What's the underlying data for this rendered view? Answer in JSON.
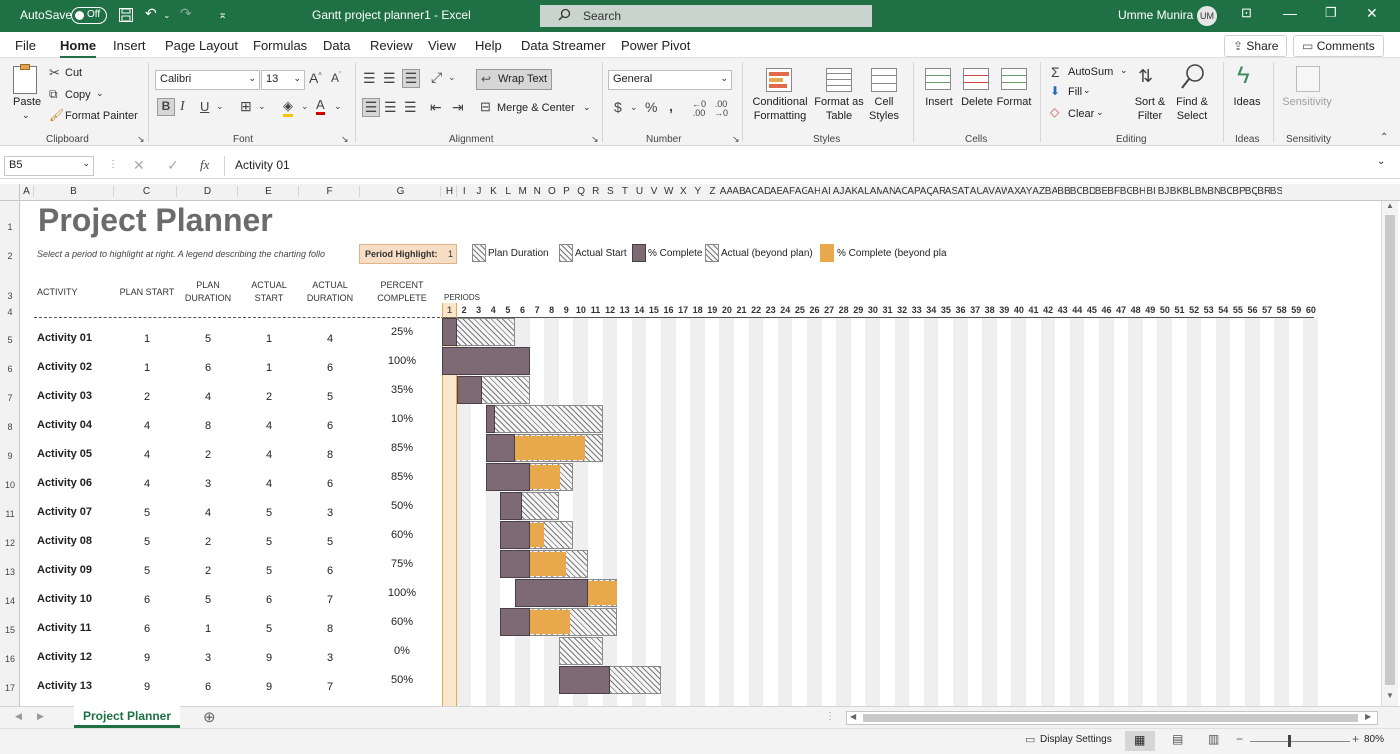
{
  "titlebar": {
    "autosave_label": "AutoSave",
    "autosave_state": "Off",
    "doc_title": "Gantt project planner1  -  Excel",
    "search_placeholder": "Search",
    "user_name": "Umme Munira",
    "user_initials": "UM"
  },
  "menu": {
    "items": [
      "File",
      "Home",
      "Insert",
      "Page Layout",
      "Formulas",
      "Data",
      "Review",
      "View",
      "Help",
      "Data Streamer",
      "Power Pivot"
    ],
    "active": "Home",
    "share": "Share",
    "comments": "Comments"
  },
  "ribbon": {
    "clipboard": {
      "paste": "Paste",
      "cut": "Cut",
      "copy": "Copy",
      "format_painter": "Format Painter",
      "group": "Clipboard"
    },
    "font": {
      "name": "Calibri",
      "size": "13",
      "group": "Font"
    },
    "alignment": {
      "wrap": "Wrap Text",
      "merge": "Merge & Center",
      "group": "Alignment"
    },
    "number": {
      "format": "General",
      "group": "Number"
    },
    "styles": {
      "conditional": "Conditional Formatting",
      "format_table": "Format as Table",
      "cell_styles": "Cell Styles",
      "group": "Styles"
    },
    "cells": {
      "insert": "Insert",
      "delete": "Delete",
      "format": "Format",
      "group": "Cells"
    },
    "editing": {
      "autosum": "AutoSum",
      "fill": "Fill",
      "clear": "Clear",
      "sort": "Sort & Filter",
      "find": "Find & Select",
      "group": "Editing"
    },
    "ideas": {
      "label": "Ideas",
      "group": "Ideas"
    },
    "sensitivity": {
      "label": "Sensitivity",
      "group": "Sensitivity"
    }
  },
  "formula_bar": {
    "name_box": "B5",
    "formula": "Activity 01"
  },
  "sheet": {
    "title": "Project Planner",
    "subtitle": "Select a period to highlight at right.  A legend describing the charting follo",
    "period_highlight_label": "Period Highlight:",
    "period_highlight_value": "1",
    "legend": [
      "Plan Duration",
      "Actual Start",
      "% Complete",
      "Actual (beyond plan)",
      "% Complete (beyond pla"
    ],
    "headers": {
      "activity": "ACTIVITY",
      "plan_start": "PLAN START",
      "plan_duration": "PLAN DURATION",
      "actual_start": "ACTUAL START",
      "actual_duration": "ACTUAL DURATION",
      "percent_complete": "PERCENT COMPLETE",
      "periods": "PERIODS"
    },
    "columns": [
      "A",
      "B",
      "C",
      "D",
      "E",
      "F",
      "G",
      "H",
      "I",
      "J",
      "K",
      "L",
      "M",
      "N",
      "O",
      "P",
      "Q",
      "R",
      "S",
      "T",
      "U",
      "V",
      "W",
      "X",
      "Y",
      "Z",
      "AA",
      "AB",
      "AC",
      "AD",
      "AE",
      "AF",
      "AG",
      "AH",
      "AI",
      "AJ",
      "AK",
      "AL",
      "AM",
      "AN",
      "AO",
      "AP",
      "AQ",
      "AR",
      "AS",
      "AT",
      "AU",
      "AV",
      "AW",
      "AX",
      "AY",
      "AZ",
      "BA",
      "BB",
      "BC",
      "BD",
      "BE",
      "BF",
      "BG",
      "BH",
      "BI",
      "BJ",
      "BK",
      "BL",
      "BM",
      "BN",
      "BO",
      "BP",
      "BQ",
      "BR",
      "BS"
    ],
    "row_numbers": [
      "1",
      "2",
      "3",
      "4",
      "5",
      "6",
      "7",
      "8",
      "9",
      "10",
      "11",
      "12",
      "13",
      "14",
      "15",
      "16",
      "17"
    ],
    "periods": [
      "1",
      "2",
      "3",
      "4",
      "5",
      "6",
      "7",
      "8",
      "9",
      "10",
      "11",
      "12",
      "13",
      "14",
      "15",
      "16",
      "17",
      "18",
      "19",
      "20",
      "21",
      "22",
      "23",
      "24",
      "25",
      "26",
      "27",
      "28",
      "29",
      "30",
      "31",
      "32",
      "33",
      "34",
      "35",
      "36",
      "37",
      "38",
      "39",
      "40",
      "41",
      "42",
      "43",
      "44",
      "45",
      "46",
      "47",
      "48",
      "49",
      "50",
      "51",
      "52",
      "53",
      "54",
      "55",
      "56",
      "57",
      "58",
      "59",
      "60"
    ],
    "activities": [
      {
        "name": "Activity 01",
        "plan_start": "1",
        "plan_duration": "5",
        "actual_start": "1",
        "actual_duration": "4",
        "percent": "25%"
      },
      {
        "name": "Activity 02",
        "plan_start": "1",
        "plan_duration": "6",
        "actual_start": "1",
        "actual_duration": "6",
        "percent": "100%"
      },
      {
        "name": "Activity 03",
        "plan_start": "2",
        "plan_duration": "4",
        "actual_start": "2",
        "actual_duration": "5",
        "percent": "35%"
      },
      {
        "name": "Activity 04",
        "plan_start": "4",
        "plan_duration": "8",
        "actual_start": "4",
        "actual_duration": "6",
        "percent": "10%"
      },
      {
        "name": "Activity 05",
        "plan_start": "4",
        "plan_duration": "2",
        "actual_start": "4",
        "actual_duration": "8",
        "percent": "85%"
      },
      {
        "name": "Activity 06",
        "plan_start": "4",
        "plan_duration": "3",
        "actual_start": "4",
        "actual_duration": "6",
        "percent": "85%"
      },
      {
        "name": "Activity 07",
        "plan_start": "5",
        "plan_duration": "4",
        "actual_start": "5",
        "actual_duration": "3",
        "percent": "50%"
      },
      {
        "name": "Activity 08",
        "plan_start": "5",
        "plan_duration": "2",
        "actual_start": "5",
        "actual_duration": "5",
        "percent": "60%"
      },
      {
        "name": "Activity 09",
        "plan_start": "5",
        "plan_duration": "2",
        "actual_start": "5",
        "actual_duration": "6",
        "percent": "75%"
      },
      {
        "name": "Activity 10",
        "plan_start": "6",
        "plan_duration": "5",
        "actual_start": "6",
        "actual_duration": "7",
        "percent": "100%"
      },
      {
        "name": "Activity 11",
        "plan_start": "6",
        "plan_duration": "1",
        "actual_start": "5",
        "actual_duration": "8",
        "percent": "60%"
      },
      {
        "name": "Activity 12",
        "plan_start": "9",
        "plan_duration": "3",
        "actual_start": "9",
        "actual_duration": "3",
        "percent": "0%"
      },
      {
        "name": "Activity 13",
        "plan_start": "9",
        "plan_duration": "6",
        "actual_start": "9",
        "actual_duration": "7",
        "percent": "50%"
      }
    ]
  },
  "tabs": {
    "sheet_tab": "Project Planner"
  },
  "status": {
    "display_settings": "Display Settings",
    "zoom": "80%"
  },
  "colors": {
    "excel_green": "#1f7145",
    "actual": "#7d6a75",
    "complete": "#e8a84c"
  }
}
